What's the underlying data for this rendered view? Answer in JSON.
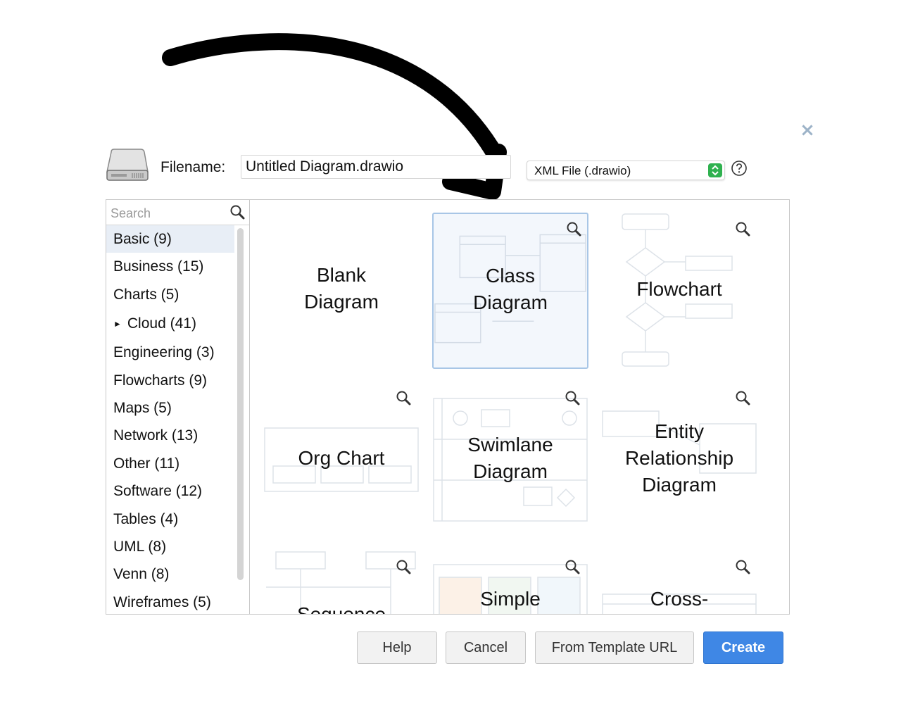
{
  "dialog": {
    "filename_label": "Filename:",
    "filename_value": "Untitled Diagram.drawio",
    "format_selected": "XML File (.drawio)",
    "close_glyph": "×"
  },
  "search": {
    "placeholder": "Search"
  },
  "categories": [
    {
      "label": "Basic (9)"
    },
    {
      "label": "Business (15)"
    },
    {
      "label": "Charts (5)"
    },
    {
      "label": "Cloud (41)"
    },
    {
      "label": "Engineering (3)"
    },
    {
      "label": "Flowcharts (9)"
    },
    {
      "label": "Maps (5)"
    },
    {
      "label": "Network (13)"
    },
    {
      "label": "Other (11)"
    },
    {
      "label": "Software (12)"
    },
    {
      "label": "Tables (4)"
    },
    {
      "label": "UML (8)"
    },
    {
      "label": "Venn (8)"
    },
    {
      "label": "Wireframes (5)"
    }
  ],
  "cloud_expander": "►",
  "templates": {
    "blank": [
      "Blank",
      "Diagram"
    ],
    "class": [
      "Class",
      "Diagram"
    ],
    "flowchart": [
      "Flowchart"
    ],
    "org": [
      "Org Chart"
    ],
    "swimlane": [
      "Swimlane",
      "Diagram"
    ],
    "entity": [
      "Entity",
      "Relationship",
      "Diagram"
    ],
    "sequence": [
      "Sequence"
    ],
    "simple": [
      "Simple"
    ],
    "cross": [
      "Cross-"
    ]
  },
  "buttons": {
    "help": "Help",
    "cancel": "Cancel",
    "template_url": "From Template URL",
    "create": "Create"
  },
  "colors": {
    "accent": "#3f87e5",
    "selection": "#a8c6e6",
    "format_stepper": "#2fb14f"
  }
}
